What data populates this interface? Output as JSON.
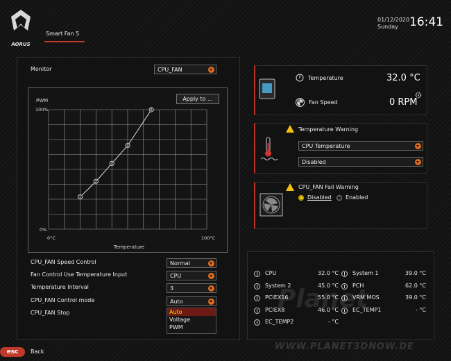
{
  "header": {
    "brand": "AORUS",
    "tab_label": "Smart Fan 5",
    "date": "01/12/2020",
    "day": "Sunday",
    "time": "16:41",
    "accent_color": "#c0392b"
  },
  "monitor": {
    "label": "Monitor",
    "selected_fan": "CPU_FAN",
    "apply_button": "Apply to ..."
  },
  "chart_data": {
    "type": "line",
    "xlabel": "Temperature",
    "ylabel": "PWM",
    "x_tick_labels": [
      "0°C",
      "100°C"
    ],
    "y_tick_labels": [
      "0%",
      "100%"
    ],
    "xlim": [
      0,
      100
    ],
    "ylim": [
      0,
      100
    ],
    "grid": true,
    "points": [
      {
        "label": "1",
        "x": 20,
        "y": 27
      },
      {
        "label": "2",
        "x": 30,
        "y": 40
      },
      {
        "label": "3",
        "x": 40,
        "y": 55
      },
      {
        "label": "4",
        "x": 50,
        "y": 70
      },
      {
        "label": "5",
        "x": 65,
        "y": 100
      }
    ]
  },
  "settings": [
    {
      "label": "CPU_FAN Speed Control",
      "value": "Normal"
    },
    {
      "label": "Fan Control Use Temperature Input",
      "value": "CPU"
    },
    {
      "label": "Temperature Interval",
      "value": "3"
    },
    {
      "label": "CPU_FAN Control mode",
      "value": "Auto"
    },
    {
      "label": "CPU_FAN Stop",
      "value": ""
    }
  ],
  "control_mode_options": [
    "Auto",
    "Voltage",
    "PWM"
  ],
  "control_mode_selected": "Auto",
  "status": {
    "temperature_label": "Temperature",
    "temperature_value": "32.0 °C",
    "fan_speed_label": "Fan Speed",
    "fan_speed_value": "0 RPM"
  },
  "temperature_warning": {
    "title": "Temperature Warning",
    "source": "CPU Temperature",
    "value": "Disabled"
  },
  "fan_fail_warning": {
    "title": "CPU_FAN Fail Warning",
    "option_disabled": "Disabled",
    "option_enabled": "Enabled",
    "selected": "Disabled"
  },
  "sensors": [
    {
      "name": "CPU",
      "value": "32.0 °C"
    },
    {
      "name": "System 1",
      "value": "39.0 °C"
    },
    {
      "name": "System 2",
      "value": "45.0 °C"
    },
    {
      "name": "PCH",
      "value": "62.0 °C"
    },
    {
      "name": "PCIEX16",
      "value": "55.0 °C"
    },
    {
      "name": "VRM MOS",
      "value": "39.0 °C"
    },
    {
      "name": "PCIEX8",
      "value": "46.0 °C"
    },
    {
      "name": "EC_TEMP1",
      "value": "- °C"
    },
    {
      "name": "EC_TEMP2",
      "value": "- °C"
    }
  ],
  "footer": {
    "esc_label": "esc",
    "back_label": "Back"
  },
  "watermark": {
    "logo": "Planet",
    "site": "WWW.PLANET3DNOW.DE"
  }
}
